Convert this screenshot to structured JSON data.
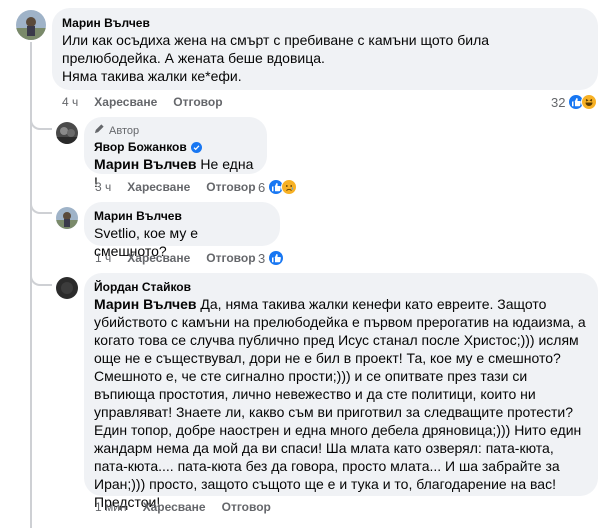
{
  "comments": [
    {
      "author": "Марин Вълчев",
      "text": "Или как осъдиха жена на смърт с пребиване с камъни щото била прелюбодейка. А жената беше вдовица.\nНяма такива жалки ке*ефи.",
      "time": "4 ч",
      "like_label": "Харесване",
      "reply_label": "Отговор",
      "reaction_count": "32"
    },
    {
      "badge": "Автор",
      "author": "Явор Божанков",
      "mention": "Марин Вълчев",
      "text": " Не една !",
      "time": "3 ч",
      "like_label": "Харесване",
      "reply_label": "Отговор",
      "reaction_count": "6"
    },
    {
      "author": "Марин Вълчев",
      "text": "Svetlio, кое му е смешното?",
      "time": "1 ч",
      "like_label": "Харесване",
      "reply_label": "Отговор",
      "reaction_count": "3"
    },
    {
      "author": "Йордан Стайков",
      "mention": "Марин Вълчев",
      "text": " Да, няма такива жалки кенефи като евреите. Защото убийството с камъни на прелюбодейка е първом прерогатив на юдаизма, а когато това се случва публично пред Исус станал после Христос;))) ислям още не е съществувал, дори не е бил в проект! Та, кое му е смешното? Смешното е, че сте сигнално прости;))) и се опитвате през тази си въпиюща простотия, лично невежество и да сте политици, които ни управляват! Знаете ли, какво съм ви приготвил за следващите протести? Един топор, добре наострен и една много дебела дряновица;))) Нито един жандарм нема да мой да ви спаси! Ша млата като озверял: пата-кюта, пата-кюта.... пата-кюта без да говора, просто млата... И ша забрайте за Иран;))) просто, защото същото ще е и тука и то, благодарение на вас! Предстои!",
      "time": "1 мин",
      "like_label": "Харесване",
      "reply_label": "Отговор"
    }
  ],
  "colors": {
    "bubble": "#f0f2f5",
    "like_blue": "#1877f2",
    "meta_gray": "#65676b"
  }
}
